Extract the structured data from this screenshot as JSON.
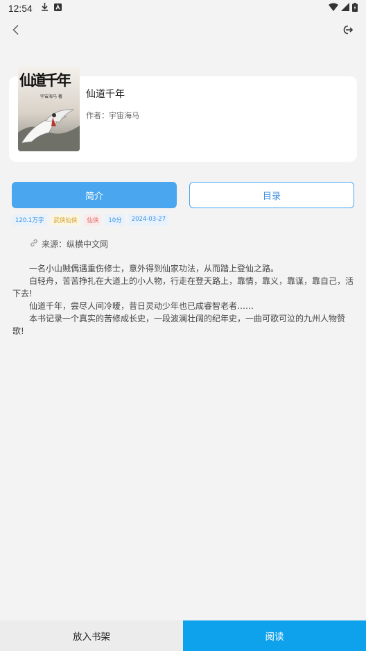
{
  "status_bar": {
    "time": "12:54",
    "icons": [
      "download-icon",
      "keyboard-a-icon",
      "wifi-icon",
      "cell-signal-icon",
      "battery-icon"
    ]
  },
  "header": {
    "back_icon": "chevron-left-icon",
    "exit_icon": "logout-icon"
  },
  "book": {
    "title": "仙道千年",
    "author_label": "作者：",
    "author": "宇宙海马",
    "cover_text": "仙道千年",
    "cover_subtext": "宇宙海马 著"
  },
  "tabs": {
    "intro": "简介",
    "toc": "目录"
  },
  "tags": [
    {
      "text": "120.1万字",
      "color": "#3a8ee0",
      "bg": "#e8f2fc"
    },
    {
      "text": "武侠仙侠",
      "color": "#d4a12a",
      "bg": "#fbf5e2"
    },
    {
      "text": "仙侠",
      "color": "#e0686a",
      "bg": "#fbeaea"
    },
    {
      "text": "10分",
      "color": "#3a8ee0",
      "bg": "#e8f2fc"
    },
    {
      "text": "2024-03-27",
      "color": "#3a8ee0",
      "bg": "#e8f2fc"
    }
  ],
  "source": {
    "icon": "link-icon",
    "text": "来源：纵横中文网"
  },
  "description": [
    "一名小山贼偶遇重伤修士，意外得到仙家功法，从而踏上登仙之路。",
    "白轻舟，苦苦挣扎在大道上的小人物，行走在登天路上，靠情，靠义，靠谋，靠自己，活下去!",
    "仙道千年，尝尽人间冷暖，昔日灵动少年也已成睿智老者……",
    "本书记录一个真实的苦修成长史，一段波澜壮阔的纪年史，一曲可歌可泣的九州人物赞歌!"
  ],
  "bottom": {
    "shelf": "放入书架",
    "read": "阅读"
  }
}
